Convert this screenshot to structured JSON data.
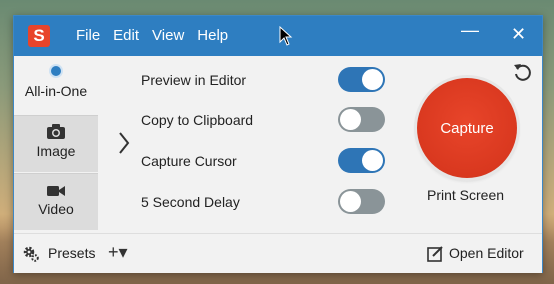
{
  "titlebar": {
    "logo_letter": "S",
    "menu": [
      "File",
      "Edit",
      "View",
      "Help"
    ],
    "minimize_glyph": "—",
    "close_glyph": "✕"
  },
  "modes": [
    {
      "label": "All-in-One",
      "icon": "radio-selected-icon",
      "active": true
    },
    {
      "label": "Image",
      "icon": "camera-icon",
      "active": false
    },
    {
      "label": "Video",
      "icon": "video-camera-icon",
      "active": false
    }
  ],
  "options": [
    {
      "label": "Preview in Editor",
      "on": true
    },
    {
      "label": "Copy to Clipboard",
      "on": false
    },
    {
      "label": "Capture Cursor",
      "on": true
    },
    {
      "label": "5 Second Delay",
      "on": false
    }
  ],
  "capture": {
    "label": "Capture",
    "shortcut": "Print Screen"
  },
  "bottom": {
    "presets": "Presets",
    "add": "+▾",
    "open_editor": "Open Editor"
  },
  "colors": {
    "titlebar": "#2e7ec1",
    "capture": "#d9381f",
    "toggle_on": "#2e75b6",
    "toggle_off": "#8a9498"
  }
}
